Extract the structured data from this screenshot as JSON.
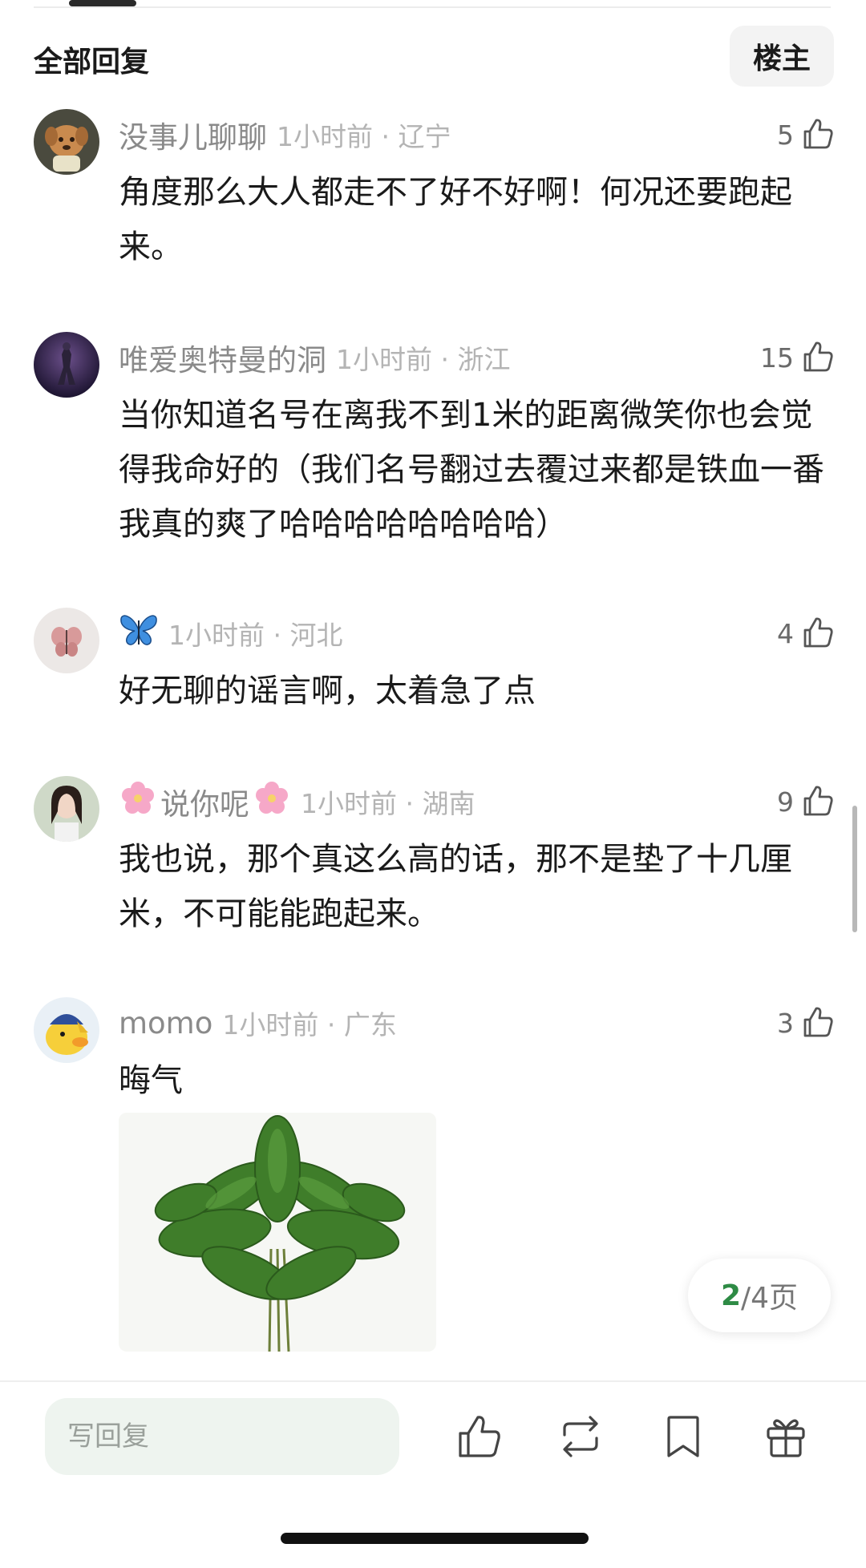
{
  "header": {
    "section_title": "全部回复",
    "op_filter_label": "楼主"
  },
  "comments": [
    {
      "user": "没事儿聊聊",
      "time": "1小时前",
      "location": "辽宁",
      "meta": "1小时前 · 辽宁",
      "likes": "5",
      "text": "角度那么大人都走不了好不好啊！何况还要跑起来。"
    },
    {
      "user": "唯爱奥特曼的洞",
      "time": "1小时前",
      "location": "浙江",
      "meta": "1小时前 · 浙江",
      "likes": "15",
      "text": "当你知道名号在离我不到1米的距离微笑你也会觉得我命好的（我们名号翻过去覆过来都是铁血一番我真的爽了哈哈哈哈哈哈哈哈）"
    },
    {
      "user": "🦋",
      "time": "1小时前",
      "location": "河北",
      "meta": "1小时前 · 河北",
      "likes": "4",
      "text": "好无聊的谣言啊，太着急了点"
    },
    {
      "user": "说你呢",
      "time": "1小时前",
      "location": "湖南",
      "meta": "1小时前 · 湖南",
      "likes": "9",
      "text": "我也说，那个真这么高的话，那不是垫了十几厘米，不可能能跑起来。"
    },
    {
      "user": "momo",
      "time": "1小时前",
      "location": "广东",
      "meta": "1小时前 · 广东",
      "likes": "3",
      "text": "晦气",
      "image_icon": "leaves-image"
    }
  ],
  "pager": {
    "current": "2",
    "total_text": "/4页"
  },
  "bottom_bar": {
    "reply_placeholder": "写回复",
    "icons": [
      "thumbs-up-icon",
      "repost-icon",
      "bookmark-icon",
      "gift-icon"
    ]
  },
  "colors": {
    "accent_green": "#2e8b45",
    "input_bg": "#eef4ef"
  }
}
